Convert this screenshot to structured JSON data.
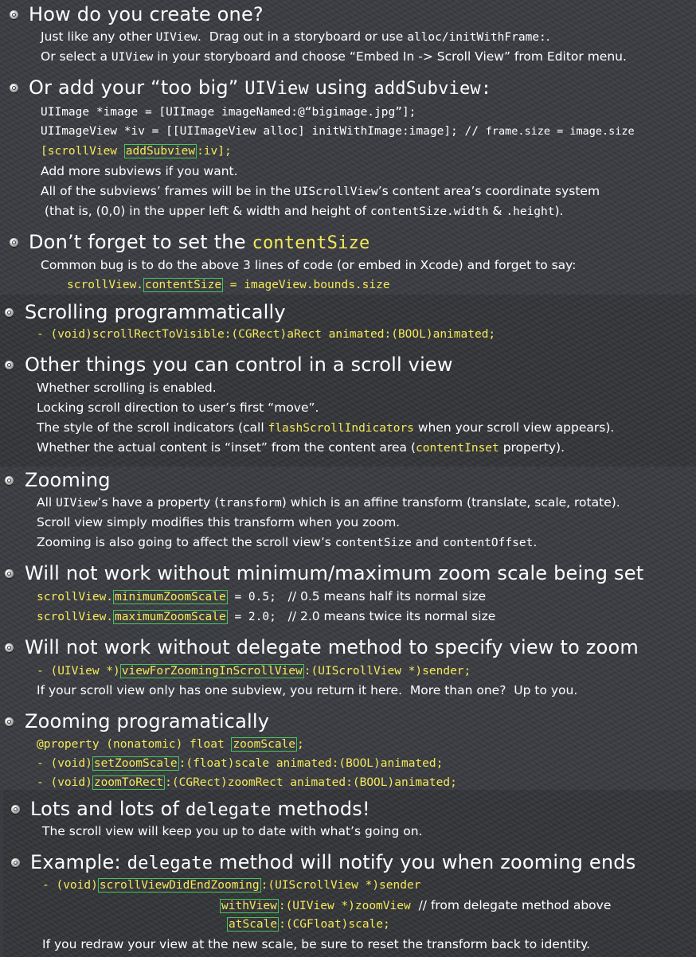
{
  "s1": {
    "h1": "How do you create one?",
    "p1a": "Just like any other ",
    "p1b": "UIView",
    "p1c": ".  Drag out in a storyboard or use ",
    "p1d": "alloc/initWithFrame:",
    "p1e": ".",
    "p2a": "Or select a ",
    "p2b": "UIView",
    "p2c": " in your storyboard and choose “Embed In -> Scroll View” from Editor menu.",
    "h2a": "Or add your “too big” ",
    "h2b": "UIView",
    "h2c": " using ",
    "h2d": "addSubview:",
    "c1": "UIImage *image = [UIImage imageNamed:@“bigimage.jpg”];",
    "c2": "UIImageView *iv = [[UIImageView alloc] initWithImage:image];",
    "c2b": " // ",
    "c2c": "frame.size = image.size",
    "c3a": "[scrollView ",
    "c3b": "addSubview",
    "c3c": ":iv];",
    "p3": "Add more subviews if you want.",
    "p4a": "All of the subviews’ frames will be in the ",
    "p4b": "UIScrollView",
    "p4c": "’s content area’s coordinate system",
    "p5a": " (that is, (0,0) in the upper left & width and height of ",
    "p5b": "contentSize.width",
    "p5c": " & ",
    "p5d": ".height",
    "p5e": ").",
    "h3a": "Don’t forget to set the ",
    "h3b": "contentSize",
    "p6": "Common bug is to do the above 3 lines of code (or embed in Xcode) and forget to say:",
    "c4a": "scrollView.",
    "c4b": "contentSize",
    "c4c": " = imageView.bounds.size"
  },
  "s2": {
    "h1": "Scrolling programmatically",
    "c1": "- (void)scrollRectToVisible:(CGRect)aRect animated:(BOOL)animated;",
    "h2": "Other things you can control in a scroll view",
    "p1": "Whether scrolling is enabled.",
    "p2": "Locking scroll direction to user’s first “move”.",
    "p3a": "The style of the scroll indicators (call ",
    "p3b": "flashScrollIndicators",
    "p3c": " when your scroll view appears).",
    "p4a": "Whether the actual content is “inset” from the content area (",
    "p4b": "contentInset",
    "p4c": " property)."
  },
  "s3": {
    "h1": "Zooming",
    "p1a": "All ",
    "p1b": "UIView",
    "p1c": "’s have a property (",
    "p1d": "transform",
    "p1e": ") which is an affine transform (translate, scale, rotate).",
    "p2": "Scroll view simply modifies this transform when you zoom.",
    "p3a": "Zooming is also going to affect the scroll view’s ",
    "p3b": "contentSize",
    "p3c": " and ",
    "p3d": "contentOffset",
    "p3e": ".",
    "h2": "Will not work without minimum/maximum zoom scale being set",
    "c1a": "scrollView.",
    "c1b": "minimumZoomScale",
    "c1c": " = 0.5;",
    "c1d": "   // 0.5 means half its normal size",
    "c2a": "scrollView.",
    "c2b": "maximumZoomScale",
    "c2c": " = 2.0;",
    "c2d": "   // 2.0 means twice its normal size",
    "h3": "Will not work without delegate method to specify view to zoom",
    "c3a": "- (UIView *)",
    "c3b": "viewForZoomingInScrollView",
    "c3c": ":(UIScrollView *)sender;",
    "p4": "If your scroll view only has one subview, you return it here.  More than one?  Up to you.",
    "h4": "Zooming programatically",
    "c4a": "@property (nonatomic) float ",
    "c4b": "zoomScale",
    "c4c": ";",
    "c5a": "- (void)",
    "c5b": "setZoomScale",
    "c5c": ":(float)scale animated:(BOOL)animated;",
    "c6a": "- (void)",
    "c6b": "zoomToRect",
    "c6c": ":(CGRect)zoomRect animated:(BOOL)animated;"
  },
  "s4": {
    "h1a": "Lots and lots of ",
    "h1b": "delegate",
    "h1c": " methods!",
    "p1": "The scroll view will keep you up to date with what’s going on.",
    "h2a": "Example: ",
    "h2b": "delegate",
    "h2c": " method will notify you when zooming ends",
    "c1a": "- (void)",
    "c1b": "scrollViewDidEndZooming",
    "c1c": ":(UIScrollView *)sender",
    "c2b": "withView",
    "c2c": ":(UIView *)zoomView",
    "c2d": "  // from delegate method above",
    "c3b": "atScale",
    "c3c": ":(CGFloat)scale;",
    "p2": "If you redraw your view at the new scale, be sure to reset the transform back to identity."
  }
}
